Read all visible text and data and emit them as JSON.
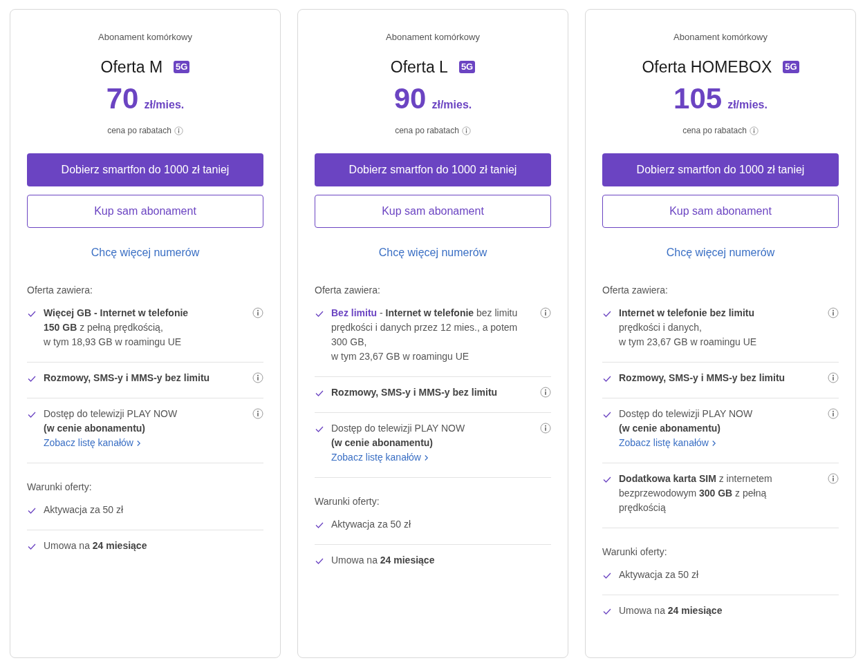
{
  "offers": [
    {
      "category": "Abonament komórkowy",
      "name": "Oferta M",
      "badge": "5G",
      "price": "70",
      "unit": "zł/mies.",
      "price_note": "cena po rabatach",
      "primary_button": "Dobierz smartfon do 1000 zł taniej",
      "secondary_button": "Kup sam abonament",
      "more_link": "Chcę więcej numerów",
      "includes_title": "Oferta zawiera:",
      "features": [
        {
          "text": "**Więcej GB - Internet w telefonie**\n**150 GB** z pełną prędkością,\nw tym 18,93 GB w roamingu UE"
        },
        {
          "text": "**Rozmowy, SMS-y i MMS-y bez limitu**"
        },
        {
          "text": "Dostęp do telewizji PLAY NOW\n**(w cenie abonamentu)**",
          "link": "Zobacz listę kanałów"
        }
      ],
      "conditions_title": "Warunki oferty:",
      "conditions": [
        {
          "text": "Aktywacja za 50 zł"
        },
        {
          "text": "Umowa na **24 miesiące**"
        }
      ]
    },
    {
      "category": "Abonament komórkowy",
      "name": "Oferta L",
      "badge": "5G",
      "price": "90",
      "unit": "zł/mies.",
      "price_note": "cena po rabatach",
      "primary_button": "Dobierz smartfon do 1000 zł taniej",
      "secondary_button": "Kup sam abonament",
      "more_link": "Chcę więcej numerów",
      "includes_title": "Oferta zawiera:",
      "features": [
        {
          "highlight": "Bez limitu",
          "text": " - **Internet w telefonie** bez limitu\nprędkości i danych przez 12 mies., a potem\n300 GB,\nw tym 23,67 GB w roamingu UE"
        },
        {
          "text": "**Rozmowy, SMS-y i MMS-y bez limitu**"
        },
        {
          "text": "Dostęp do telewizji PLAY NOW\n**(w cenie abonamentu)**",
          "link": "Zobacz listę kanałów"
        }
      ],
      "conditions_title": "Warunki oferty:",
      "conditions": [
        {
          "text": "Aktywacja za 50 zł"
        },
        {
          "text": "Umowa na **24 miesiące**"
        }
      ]
    },
    {
      "category": "Abonament komórkowy",
      "name": "Oferta HOMEBOX",
      "badge": "5G",
      "price": "105",
      "unit": "zł/mies.",
      "price_note": "cena po rabatach",
      "primary_button": "Dobierz smartfon do 1000 zł taniej",
      "secondary_button": "Kup sam abonament",
      "more_link": "Chcę więcej numerów",
      "includes_title": "Oferta zawiera:",
      "features": [
        {
          "text": "**Internet w telefonie bez limitu**\nprędkości i danych,\nw tym 23,67 GB w roamingu UE"
        },
        {
          "text": "**Rozmowy, SMS-y i MMS-y bez limitu**"
        },
        {
          "text": "Dostęp do telewizji PLAY NOW\n**(w cenie abonamentu)**",
          "link": "Zobacz listę kanałów"
        },
        {
          "text": "**Dodatkowa karta SIM** z internetem\nbezprzewodowym **300 GB** z pełną\nprędkością"
        }
      ],
      "conditions_title": "Warunki oferty:",
      "conditions": [
        {
          "text": "Aktywacja za 50 zł"
        },
        {
          "text": "Umowa na **24 miesiące**"
        }
      ]
    }
  ]
}
